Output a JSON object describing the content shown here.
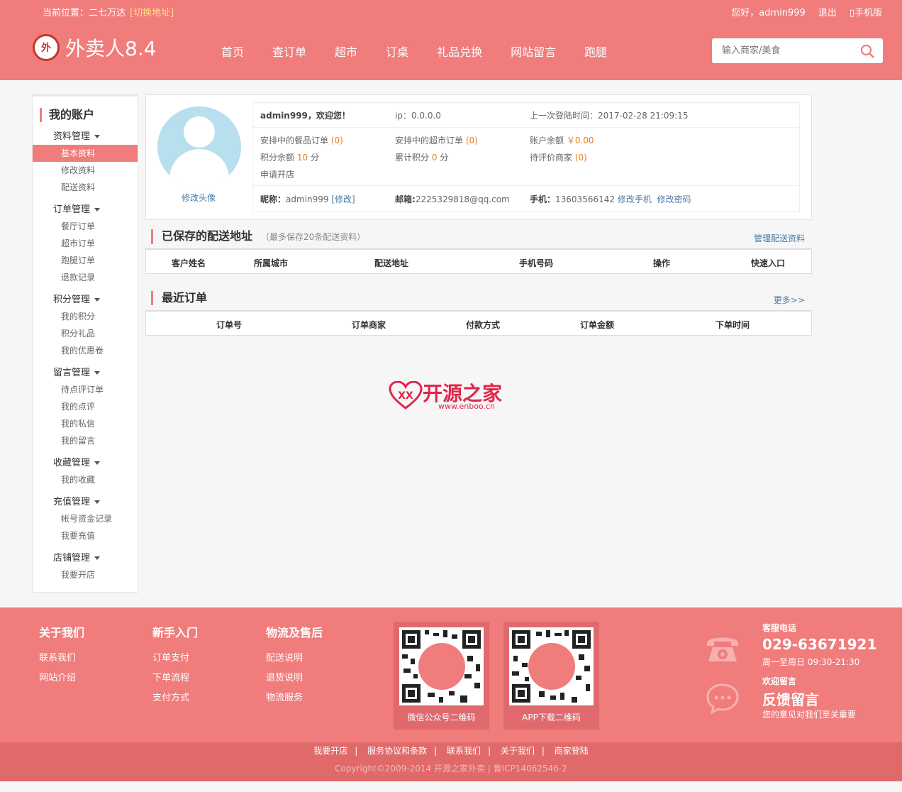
{
  "topbar": {
    "location_label": "当前位置：二七万达",
    "switch_address": "[切换地址]",
    "greeting": "您好，admin999",
    "logout": "退出",
    "mobile": "手机版"
  },
  "header": {
    "logo_text": "外卖人8.4",
    "logo_badge": "外",
    "nav": [
      "首页",
      "查订单",
      "超市",
      "订桌",
      "礼品兑换",
      "网站留言",
      "跑腿"
    ],
    "search_placeholder": "输入商家/美食"
  },
  "sidebar": {
    "title": "我的账户",
    "groups": [
      {
        "title": "资料管理",
        "items": [
          "基本资料",
          "修改资料",
          "配送资料"
        ]
      },
      {
        "title": "订单管理",
        "items": [
          "餐厅订单",
          "超市订单",
          "跑腿订单",
          "退款记录"
        ]
      },
      {
        "title": "积分管理",
        "items": [
          "我的积分",
          "积分礼品",
          "我的优惠卷"
        ]
      },
      {
        "title": "留言管理",
        "items": [
          "待点评订单",
          "我的点评",
          "我的私信",
          "我的留言"
        ]
      },
      {
        "title": "收藏管理",
        "items": [
          "我的收藏"
        ]
      },
      {
        "title": "充值管理",
        "items": [
          "帐号资金记录",
          "我要充值"
        ]
      },
      {
        "title": "店铺管理",
        "items": [
          "我要开店"
        ]
      }
    ]
  },
  "profile": {
    "change_avatar": "修改头像",
    "welcome_user": "admin999",
    "welcome_suffix": "，欢迎您！",
    "ip": "ip：0.0.0.0",
    "last_login": "上一次登陆时间：2017-02-28 21:09:15",
    "meal_orders_label": "安排中的餐品订单",
    "meal_orders_count": "(0)",
    "market_orders_label": "安排中的超市订单",
    "market_orders_count": "(0)",
    "balance_label": "账户余额",
    "balance_value": "￥0.00",
    "points_label": "积分余额",
    "points_value": "10",
    "points_unit": "分",
    "total_points_label": "累计积分",
    "total_points_value": "0",
    "total_points_unit": "分",
    "pending_review_label": "待评价商家",
    "pending_review_count": "(0)",
    "apply_shop": "申请开店",
    "nickname_label": "昵称：",
    "nickname_value": "admin999",
    "nickname_edit": "[修改]",
    "email_label": "邮箱:",
    "email_value": "2225329818@qq.com",
    "phone_label": "手机：",
    "phone_value": "13603566142",
    "change_phone": "修改手机",
    "change_password": "修改密码"
  },
  "address_section": {
    "title": "已保存的配送地址",
    "note": "（最多保存20条配送资料）",
    "manage_link": "管理配送资料",
    "columns": [
      "客户姓名",
      "所属城市",
      "配送地址",
      "手机号码",
      "操作",
      "快速入口"
    ]
  },
  "orders_section": {
    "title": "最近订单",
    "more_link": "更多>>",
    "columns": [
      "订单号",
      "订单商家",
      "付款方式",
      "订单金额",
      "下单时间"
    ]
  },
  "watermark": {
    "title": "开源之家",
    "url": "www.enboo.cn"
  },
  "footer": {
    "columns": [
      {
        "heading": "关于我们",
        "links": [
          "联系我们",
          "网站介绍"
        ]
      },
      {
        "heading": "新手入门",
        "links": [
          "订单支付",
          "下单流程",
          "支付方式"
        ]
      },
      {
        "heading": "物流及售后",
        "links": [
          "配送说明",
          "退货说明",
          "物流服务"
        ]
      }
    ],
    "qr_wechat": "微信公众号二维码",
    "qr_app": "APP下载二维码",
    "service_label": "客服电话",
    "service_phone": "029-63671921",
    "service_hours": "周一至周日 09:30-21:30",
    "feedback_label": "欢迎留言",
    "feedback_title": "反馈留言",
    "feedback_desc": "您的意见对我们至关重要",
    "bottom_links": [
      "我要开店",
      "服务协议和条款",
      "联系我们",
      "关于我们",
      "商家登陆"
    ],
    "copyright": "Copyright©2009-2014 开源之家外卖 | 鲁ICP14062546-2"
  },
  "colors": {
    "brand": "#f07c7c",
    "link": "#4a7aa6",
    "accent": "#e67e22"
  }
}
